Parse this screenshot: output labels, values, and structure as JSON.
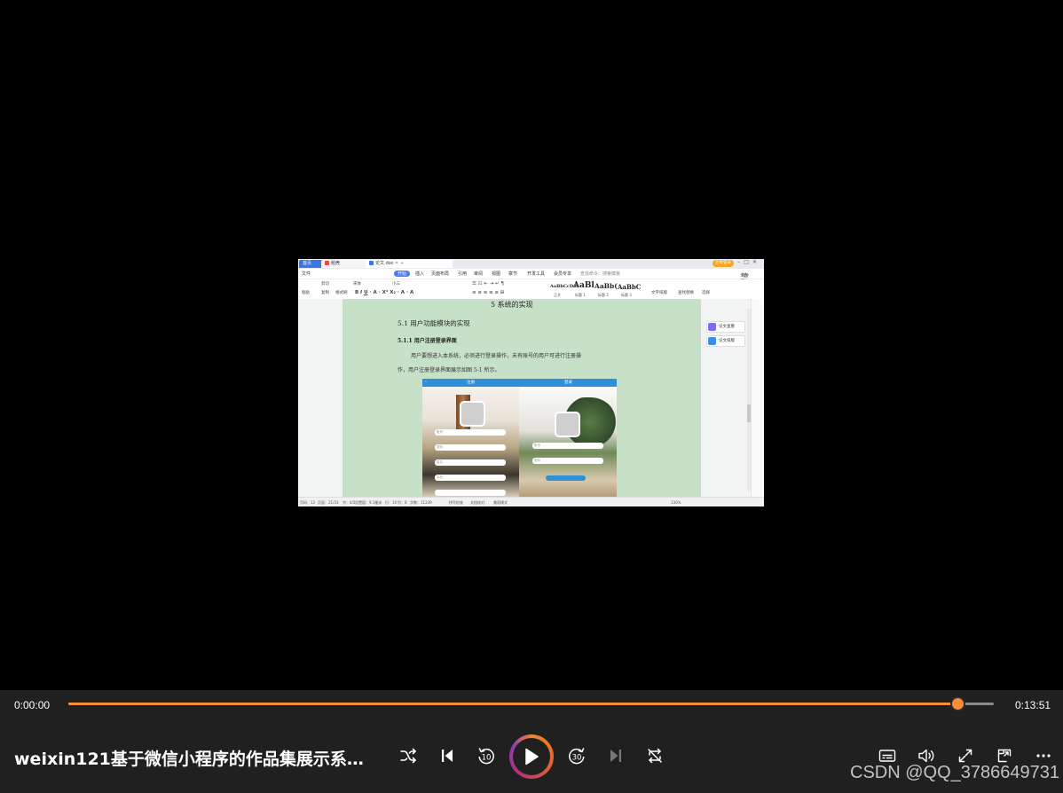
{
  "video": {
    "app_tabs": {
      "home": "首页",
      "tab2": "稻壳",
      "tab3": "论文.doc",
      "login": "立即登录"
    },
    "menu": [
      "文件",
      "开始",
      "插入",
      "页面布局",
      "引用",
      "审阅",
      "视图",
      "章节",
      "开发工具",
      "会员专享"
    ],
    "menu_search": "查找命令、搜索模板",
    "menu_right": [
      "未同步",
      "协作",
      "分享"
    ],
    "ribbon": {
      "paste": "粘贴",
      "cut": "剪切",
      "copy": "复制",
      "format_painter": "格式刷",
      "font": "宋体",
      "size": "小三",
      "styles": [
        {
          "preview": "AaBbCcDd",
          "name": "正文"
        },
        {
          "preview": "AaBl",
          "name": "标题 1"
        },
        {
          "preview": "AaBb(",
          "name": "标题 2"
        },
        {
          "preview": "AaBbC",
          "name": "标题 3"
        }
      ],
      "text_layout": "文字排版",
      "find_replace": "查找替换",
      "select": "选择"
    },
    "doc": {
      "heading_cut": "5 系统的实现",
      "section": "5.1 用户功能模块的实现",
      "subsection": "5.1.1 用户注册登录界面",
      "para_line1": "用户要想进入本系统，必须进行登录操作，未有账号的用户可进行注册操",
      "para_line2": "作，用户注册登录界面展示如图 5-1 所示。",
      "shot_tabs": [
        "注册",
        "登录"
      ],
      "shot_fields_left": [
        "账号",
        "密码",
        "姓名",
        "手机"
      ],
      "shot_fields_right": [
        "账号",
        "密码"
      ]
    },
    "assistant": [
      "论文查重",
      "论文排版"
    ],
    "status": [
      "页码：12",
      "页面：21/33",
      "节：4/5",
      "设置值：9.1厘米",
      "行：10",
      "列：8",
      "字数：11239",
      "拼写检查",
      "文档校对",
      "兼容模式",
      "130%"
    ]
  },
  "player": {
    "current_time": "0:00:00",
    "duration": "0:13:51",
    "progress": 0.961,
    "title": "weixin121基于微信小程序的作品集展示系统…",
    "accent": "#fb8c3a",
    "icons": [
      "shuffle-icon",
      "previous-icon",
      "rewind-10-icon",
      "play-icon",
      "forward-30-icon",
      "next-icon",
      "repeat-off-icon",
      "subtitles-icon",
      "volume-icon",
      "fullscreen-icon",
      "picture-in-picture-icon",
      "more-icon"
    ],
    "rewind_label": "10",
    "forward_label": "30"
  },
  "watermark": "CSDN @QQ_3786649731"
}
